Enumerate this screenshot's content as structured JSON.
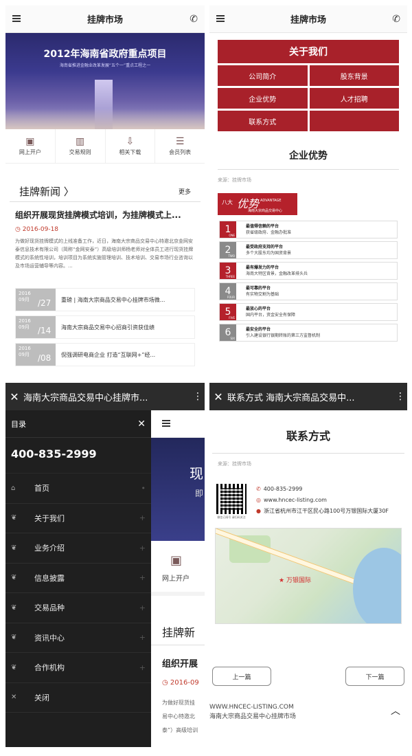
{
  "panel1": {
    "header_title": "挂牌市场",
    "banner_title": "2012年海南省政府重点项目",
    "banner_subtitle": "海南省推进金融业改革发展“五个一”重点工程之一",
    "quick": [
      "网上开户",
      "交易规则",
      "相关下载",
      "会员列表"
    ],
    "news_heading": "挂牌新闻 〉",
    "news_more": "更多",
    "feature_title": "组织开展现货挂牌模式培训，为挂牌模式上...",
    "feature_date": "2016-09-18",
    "feature_text": "为做好现货挂牌模式的上线准备工作，近日，海南大宗商品交易中心特邀北京金网安泰信息技术有限公司（简称“金网安泰”）高级培训师杨老师对全体员工进行现货挂牌模式的系统性培训，培训项目为系统实施管理培训、技术培训、交易市场行业咨询以及市场运营辅导等内容。...",
    "news": [
      {
        "year": "2016",
        "month": "09月",
        "day": "/27",
        "title": "重磅 | 海南大宗商品交易中心挂牌市场微..."
      },
      {
        "year": "2016",
        "month": "09月",
        "day": "/14",
        "title": "海南大宗商品交易中心招商引资获佳绩"
      },
      {
        "year": "2016",
        "month": "09月",
        "day": "/08",
        "title": "倪强调研电商企业 打造“互联网+”经..."
      }
    ]
  },
  "panel2": {
    "header_title": "挂牌市场",
    "about_title": "关于我们",
    "grid": [
      [
        "公司简介",
        "股东背景"
      ],
      [
        "企业优势",
        "人才招聘"
      ],
      [
        "联系方式",
        ""
      ]
    ],
    "section_title": "企业优势",
    "source": "来源：挂牌市场",
    "adv_banner": {
      "prefix": "八大",
      "main": "优势",
      "en": "ADVANTAGE",
      "sub": "海南大宗商品交易中心"
    },
    "advantages": [
      {
        "num": "1",
        "en": "ONE",
        "title": "最值得信赖的平台",
        "desc": "获省级政府、金融办批准",
        "color": "#b5212b"
      },
      {
        "num": "2",
        "en": "TWO",
        "title": "最受政府支持的平台",
        "desc": "多个大股东均为国资背景",
        "color": "#8a8a8a"
      },
      {
        "num": "3",
        "en": "THREE",
        "title": "最有爆发力的平台",
        "desc": "海南大特区背景，金融改革排头兵",
        "color": "#b5212b"
      },
      {
        "num": "4",
        "en": "FOUR",
        "title": "最可靠的平台",
        "desc": "有实物交割为基础",
        "color": "#8a8a8a"
      },
      {
        "num": "5",
        "en": "FIVE",
        "title": "最放心的平台",
        "desc": "国内平台，资金安全有保障",
        "color": "#b5212b"
      },
      {
        "num": "6",
        "en": "SIX",
        "title": "最安全的平台",
        "desc": "引入建设银行银期转账的第三方监督机制",
        "color": "#8a8a8a"
      }
    ]
  },
  "panel3": {
    "window_title": "海南大宗商品交易中心挂牌市...",
    "drawer_title": "目录",
    "phone": "400-835-2999",
    "menu": [
      {
        "icon": "home-icon",
        "label": "首页"
      },
      {
        "icon": "leaf-icon",
        "label": "关于我们"
      },
      {
        "icon": "leaf-icon",
        "label": "业务介绍"
      },
      {
        "icon": "leaf-icon",
        "label": "信息披露"
      },
      {
        "icon": "leaf-icon",
        "label": "交易品种"
      },
      {
        "icon": "leaf-icon",
        "label": "资讯中心"
      },
      {
        "icon": "leaf-icon",
        "label": "合作机构"
      },
      {
        "icon": "close-icon",
        "label": "关闭"
      }
    ],
    "behind": {
      "banner1": "现",
      "banner2": "即",
      "quick": "网上开户",
      "news": "挂牌新",
      "feature": "组织开展",
      "date": "2016-09",
      "text": [
        "为做好现货挂",
        "易中心特邀北",
        "泰”）高级培训"
      ]
    }
  },
  "panel4": {
    "window_title": "联系方式 海南大宗商品交易中...",
    "title": "联系方式",
    "source": "来源：挂牌市场",
    "qr_label": "微信订阅号 请扫码关注",
    "phone": "400-835-2999",
    "website": "www.hncec-listing.com",
    "address": "浙江省杭州市江干区民心路100号万银国际大厦30F",
    "map_pin": "万银国际",
    "prev": "上一篇",
    "next": "下一篇",
    "footer_url": "WWW.HNCEC-LISTING.COM",
    "footer_name": "海南大宗商品交易中心挂牌市场"
  }
}
